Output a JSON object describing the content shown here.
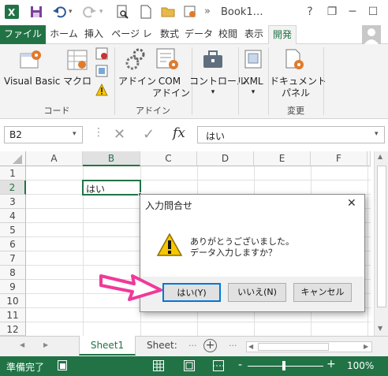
{
  "titlebar": {
    "book_title": "Book1…",
    "more": "»",
    "help": "?",
    "restore": "❐",
    "minimize": "─",
    "maximize": "☐",
    "close": "✕"
  },
  "tabs": [
    "ファイル",
    "ホーム",
    "挿入",
    "ページ レイ",
    "数式",
    "データ",
    "校閲",
    "表示",
    "開発"
  ],
  "ribbon": {
    "visual_basic": "Visual Basic",
    "macro": "マクロ",
    "group_code": "コード",
    "addin": "アドイン",
    "com_addin_1": "COM",
    "com_addin_2": "アドイン",
    "group_addin": "アドイン",
    "controls": "コントロール",
    "xml": "XML",
    "doc_panel_1": "ドキュメント",
    "doc_panel_2": "パネル",
    "group_change": "変更",
    "dropdown_arrow": "▾"
  },
  "formula": {
    "namebox": "B2",
    "content": "はい",
    "fx": "fx",
    "cancel": "✕",
    "enter": "✓"
  },
  "grid": {
    "columns": [
      "A",
      "B",
      "C",
      "D",
      "E",
      "F"
    ],
    "rows": [
      "1",
      "2",
      "3",
      "4",
      "5",
      "6",
      "7",
      "8",
      "9",
      "10",
      "11",
      "12"
    ],
    "b2_value": "はい"
  },
  "dialog": {
    "title": "入力問合せ",
    "close": "✕",
    "line1": "ありがとうございました。",
    "line2": "データ入力しますか？",
    "yes": "はい(Y)",
    "no": "いいえ(N)",
    "cancel": "キャンセル",
    "warning_glyph": "!"
  },
  "sheetbar": {
    "sheet1": "Sheet1",
    "sheet2": "Sheet:",
    "ellipsis": "...",
    "add": "+",
    "nav_prev": "◀",
    "nav_next": "▶"
  },
  "status": {
    "ready": "準備完了",
    "zoom": "100%",
    "minus": "-",
    "plus": "+"
  },
  "colors": {
    "excel_green": "#217346",
    "arrow_pink": "#f0399a",
    "warning_yellow": "#f7c600"
  },
  "icons": [
    "excel-logo-icon",
    "save-icon",
    "undo-icon",
    "redo-icon",
    "print-preview-icon",
    "new-file-icon",
    "open-folder-icon",
    "customize-icon",
    "visual-basic-icon",
    "macro-icon",
    "record-macro-icon",
    "relative-ref-icon",
    "macro-security-icon",
    "addin-gear-icon",
    "com-addin-icon",
    "controls-icon",
    "xml-icon",
    "document-panel-icon",
    "warning-icon",
    "pointer-arrow-icon"
  ]
}
